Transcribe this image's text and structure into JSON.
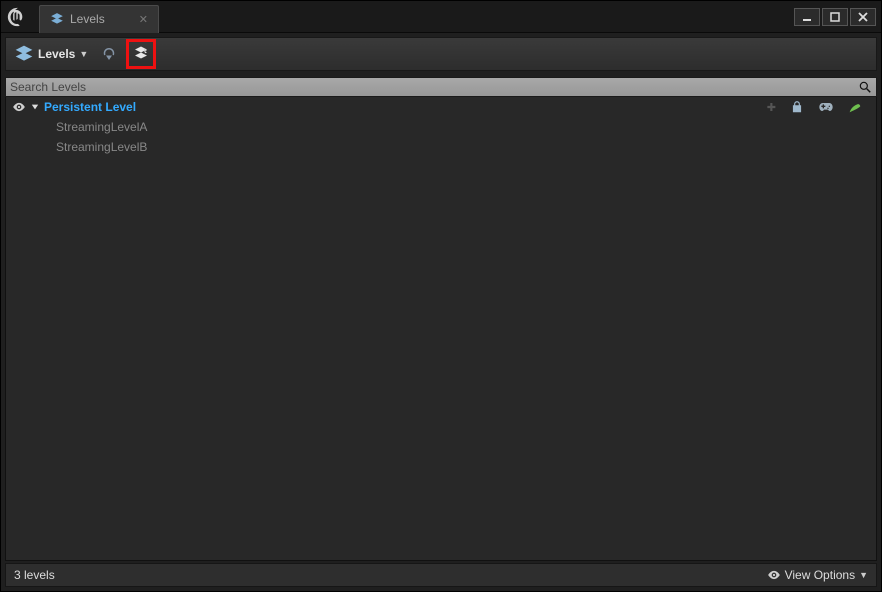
{
  "window": {
    "tab_title": "Levels"
  },
  "toolbar": {
    "levels_label": "Levels"
  },
  "search": {
    "placeholder": "Search Levels"
  },
  "levels": {
    "persistent_label": "Persistent Level",
    "children": {
      "a": "StreamingLevelA",
      "b": "StreamingLevelB"
    }
  },
  "status": {
    "count_text": "3 levels",
    "view_options_label": "View Options"
  }
}
